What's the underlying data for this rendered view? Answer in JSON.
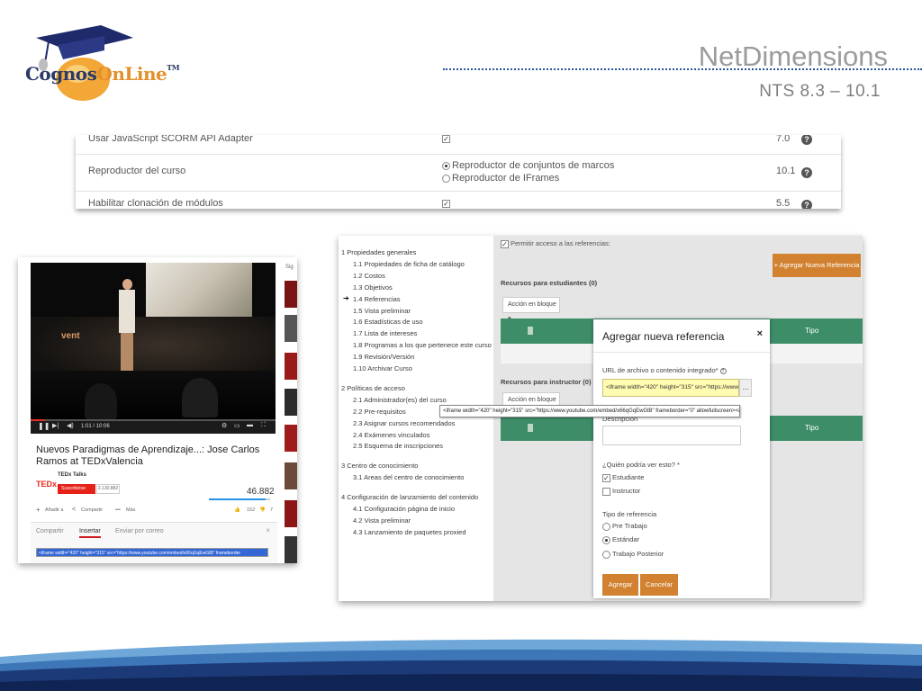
{
  "header": {
    "logo": {
      "part1": "Cognos",
      "part2": "OnLine",
      "tm": "TM"
    },
    "brand": "NetDimensions",
    "version": "NTS 8.3 – 10.1"
  },
  "settings": {
    "rows": [
      {
        "label": "Usar JavaScript SCORM API Adapter",
        "version": "7.0"
      },
      {
        "label": "Reproductor del curso",
        "version": "10.1",
        "options": [
          "Reproductor de conjuntos de marcos",
          "Reproductor de IFrames"
        ]
      },
      {
        "label": "Habilitar clonación de módulos",
        "version": "5.5"
      }
    ]
  },
  "youtube": {
    "sidebar_label": "Sig",
    "event_text": "vent",
    "time": "1:01 / 10:06",
    "progress": 0.06,
    "title": "Nuevos Paradigmas de Aprendizaje...: Jose Carlos Ramos at TEDxValencia",
    "channel": "TEDx Talks",
    "ted_logo": "TEDx",
    "subscribe": "Suscribirse",
    "subscribers": "2.130.882",
    "views": "46.882",
    "like_ratio": 0.92,
    "actions": {
      "add": "Añadir a",
      "share": "Compartir",
      "more": "Más",
      "likes": "152",
      "dislikes": "7"
    },
    "share_tabs": [
      "Compartir",
      "Insertar",
      "Enviar por correo"
    ],
    "close": "×",
    "embed_code": "<iframe width=\"420\" height=\"315\" src=\"https://www.youtube.com/embed/x66qGqEwGlB\" frameborder"
  },
  "lms": {
    "nav": [
      {
        "text": "1 Propiedades generales",
        "level": "sec"
      },
      {
        "text": "1.1 Propiedades de ficha de catálogo",
        "level": "sub"
      },
      {
        "text": "1.2 Costos",
        "level": "sub"
      },
      {
        "text": "1.3 Objetivos",
        "level": "sub"
      },
      {
        "text": "1.4 Referencias",
        "level": "sub",
        "current": true
      },
      {
        "text": "1.5 Vista preliminar",
        "level": "sub"
      },
      {
        "text": "1.6 Estadísticas de uso",
        "level": "sub"
      },
      {
        "text": "1.7 Lista de intereses",
        "level": "sub"
      },
      {
        "text": "1.8 Programas a los que pertenece este curso",
        "level": "sub"
      },
      {
        "text": "1.9 Revisión/Versión",
        "level": "sub"
      },
      {
        "text": "1.10 Archivar Curso",
        "level": "sub"
      },
      {
        "text": "2 Políticas de acceso",
        "level": "sec"
      },
      {
        "text": "2.1 Administrador(es) del curso",
        "level": "sub"
      },
      {
        "text": "2.2 Pre-requisitos",
        "level": "sub"
      },
      {
        "text": "2.3 Asignar cursos recomendados",
        "level": "sub"
      },
      {
        "text": "2.4 Exámenes vinculados",
        "level": "sub"
      },
      {
        "text": "2.5 Esquema de inscripciones",
        "level": "sub"
      },
      {
        "text": "3 Centro de conocimiento",
        "level": "sec"
      },
      {
        "text": "3.1 Areas del centro de conocimiento",
        "level": "sub"
      },
      {
        "text": "4 Configuración de lanzamiento del contenido",
        "level": "sec"
      },
      {
        "text": "4.1 Configuración página de inicio",
        "level": "sub"
      },
      {
        "text": "4.2 Vista preliminar",
        "level": "sub"
      },
      {
        "text": "4.3 Lanzamiento de paquetes proxied",
        "level": "sub"
      }
    ],
    "nav_arrow": "➔",
    "permit_label": "Permitir acceso a las referencias:",
    "add_ref_button": "+ Agregar Nueva Referencia",
    "student_section": "Recursos para estudiantes (0)",
    "instructor_section": "Recursos para instructor (0)",
    "action_select": "Acción en bloque",
    "col_tipo": "Tipo",
    "tooltip": "<iframe width=\"420\" height=\"315\" src=\"https://www.youtube.com/embed/x66qGqEwGlB\" frameborder=\"0\" allowfullscreen></iframe>",
    "modal": {
      "title": "Agregar nueva referencia",
      "close": "×",
      "url_label": "URL de archivo o contenido integrado*",
      "url_value": "<iframe width=\"420\" height=\"315\" src=\"https://www.yo",
      "url_button": "...",
      "desc_label": "Descripción",
      "who_label": "¿Quién podría ver esto? *",
      "who_options": [
        {
          "label": "Estudiante",
          "checked": true
        },
        {
          "label": "Instructor",
          "checked": false
        }
      ],
      "type_label": "Tipo de referencia",
      "type_options": [
        {
          "label": "Pre Trabajo",
          "selected": false
        },
        {
          "label": "Estándar",
          "selected": true
        },
        {
          "label": "Trabajo Posterior",
          "selected": false
        }
      ],
      "add_button": "Agregar",
      "cancel_button": "Cancelar"
    }
  },
  "colors": {
    "accent_orange": "#d1812f",
    "table_green": "#3d8d68",
    "brand_blue": "#2a56a0",
    "footer_navy": "#1d3a78"
  }
}
